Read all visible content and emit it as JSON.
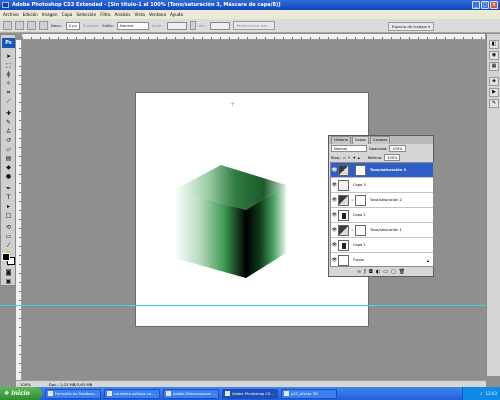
{
  "window": {
    "title": "Adobe Photoshop CS3 Extended - [Sin título-1 al 100% (Tono/saturación 3, Máscara de capa/8)]"
  },
  "menu": [
    "Archivo",
    "Edición",
    "Imagen",
    "Capa",
    "Selección",
    "Filtro",
    "Análisis",
    "Vista",
    "Ventana",
    "Ayuda"
  ],
  "options_bar": {
    "feather_label": "Desv.:",
    "feather_value": "0 px",
    "antialias_label": "Suavizar",
    "style_label": "Estilo:",
    "style_value": "Normal",
    "width_label": "Anch.:",
    "height_label": "Alt.:",
    "refine_button": "Perfeccionar bor...",
    "workspace_button": "Espacio de trabajo"
  },
  "layers_panel": {
    "tabs": [
      "Historia",
      "Capas",
      "Canales"
    ],
    "blend_mode": "Normal",
    "opacity_label": "Opacidad:",
    "opacity_value": "100%",
    "lock_label": "Bloq.:",
    "fill_label": "Relleno:",
    "fill_value": "100%",
    "layers": [
      {
        "name": "Tono/saturación 3",
        "type": "adjustment",
        "selected": true
      },
      {
        "name": "Capa 3",
        "type": "pixel",
        "selected": false
      },
      {
        "name": "Tono/saturación 2",
        "type": "adjustment",
        "selected": false
      },
      {
        "name": "Capa 2",
        "type": "pixel",
        "selected": false
      },
      {
        "name": "Tono/saturación 1",
        "type": "adjustment",
        "selected": false
      },
      {
        "name": "Capa 1",
        "type": "pixel",
        "selected": false
      },
      {
        "name": "Fondo",
        "type": "background",
        "selected": false
      }
    ]
  },
  "status_bar": {
    "zoom": "100%",
    "doc_info": "Doc.: 1,03 MB/3,63 MB"
  },
  "taskbar": {
    "start_label": "Inicio",
    "tasks": [
      "Farmville en Faceboo...",
      "carretera sultana co...",
      "Adobe Dreamweaver ...",
      "Adobe Photoshop CS...",
      "p23_efecto 3D"
    ],
    "active_task_index": 3,
    "clock": "13:03"
  },
  "colors": {
    "title_bar": "#0f46b8",
    "selected_layer": "#2f5ec7",
    "guide": "#32d7e3",
    "cube_green": "#2e8a45"
  }
}
